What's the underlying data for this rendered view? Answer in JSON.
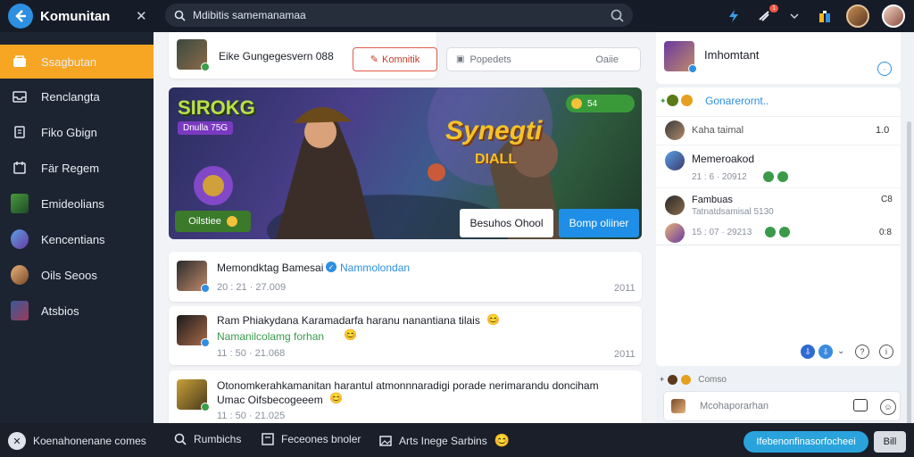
{
  "topbar": {
    "title": "Komunitan",
    "search_placeholder": "Mdibitis samemanamaa",
    "notification_badge": "1"
  },
  "sidebar": {
    "items": [
      {
        "label": "Ssagbutan",
        "active": true
      },
      {
        "label": "Renclangta"
      },
      {
        "label": "Fiko Gbign"
      },
      {
        "label": "Fär Regem"
      },
      {
        "label": "Emideolians"
      },
      {
        "label": "Kencentians"
      },
      {
        "label": "Oils Seoos"
      },
      {
        "label": "Atsbios"
      }
    ]
  },
  "composer": {
    "prompt": "Eike Gungegesvern 088",
    "button_label": "Komnitik",
    "field_left": "Popedets",
    "field_right": "Oaiie"
  },
  "banner": {
    "title_left": "SIROKG",
    "tag_left": "Dnulla 75G",
    "title_right_1": "Synegti",
    "title_right_2": "DIALL",
    "chip": "54",
    "green_button": "Oilstiee",
    "white_button": "Besuhos Ohool",
    "blue_button": "Bomp oliiner"
  },
  "posts": [
    {
      "author": "Memondktag Bamesai",
      "verified_name": "Nammolondan",
      "meta": "20 : 21 · 27.009",
      "side": "2011"
    },
    {
      "text": "Ram Phiakydana Karamadarfa haranu nanantiana tilais",
      "sub": "Namanilcolamg forhan",
      "meta": "11 : 50 · 21.068",
      "side": "2011"
    },
    {
      "text": "Otonomkerahkamanitan harantul atmonnnaradigi porade nerimarandu donciham",
      "text2": "Umac Oifsbecogeeem",
      "meta": "11 : 50 · 21.025"
    }
  ],
  "right": {
    "profile_name": "Imhomtant",
    "section_title": "Gonarerornt..",
    "rows": [
      {
        "name": "Kaha taimal",
        "value": "1.0"
      },
      {
        "name": "Memeroakod",
        "sub": "21 : 6 · 20912"
      },
      {
        "name": "Fambuas",
        "sub": "Tatnatdsamisal 5130",
        "value": "C8"
      },
      {
        "name": "",
        "sub": "15 : 07 · 29213",
        "value": "0:8"
      }
    ],
    "footer_label": "Comso",
    "chat_placeholder": "Mcohaporarhan"
  },
  "bottombar": {
    "item1": "Koenahonenane comes",
    "item2": "Rumbichs",
    "item3": "Feceones bnoler",
    "item4": "Arts Inege Sarbins",
    "pill": "Ifebenonfinasorfocheei",
    "square": "Bill"
  }
}
